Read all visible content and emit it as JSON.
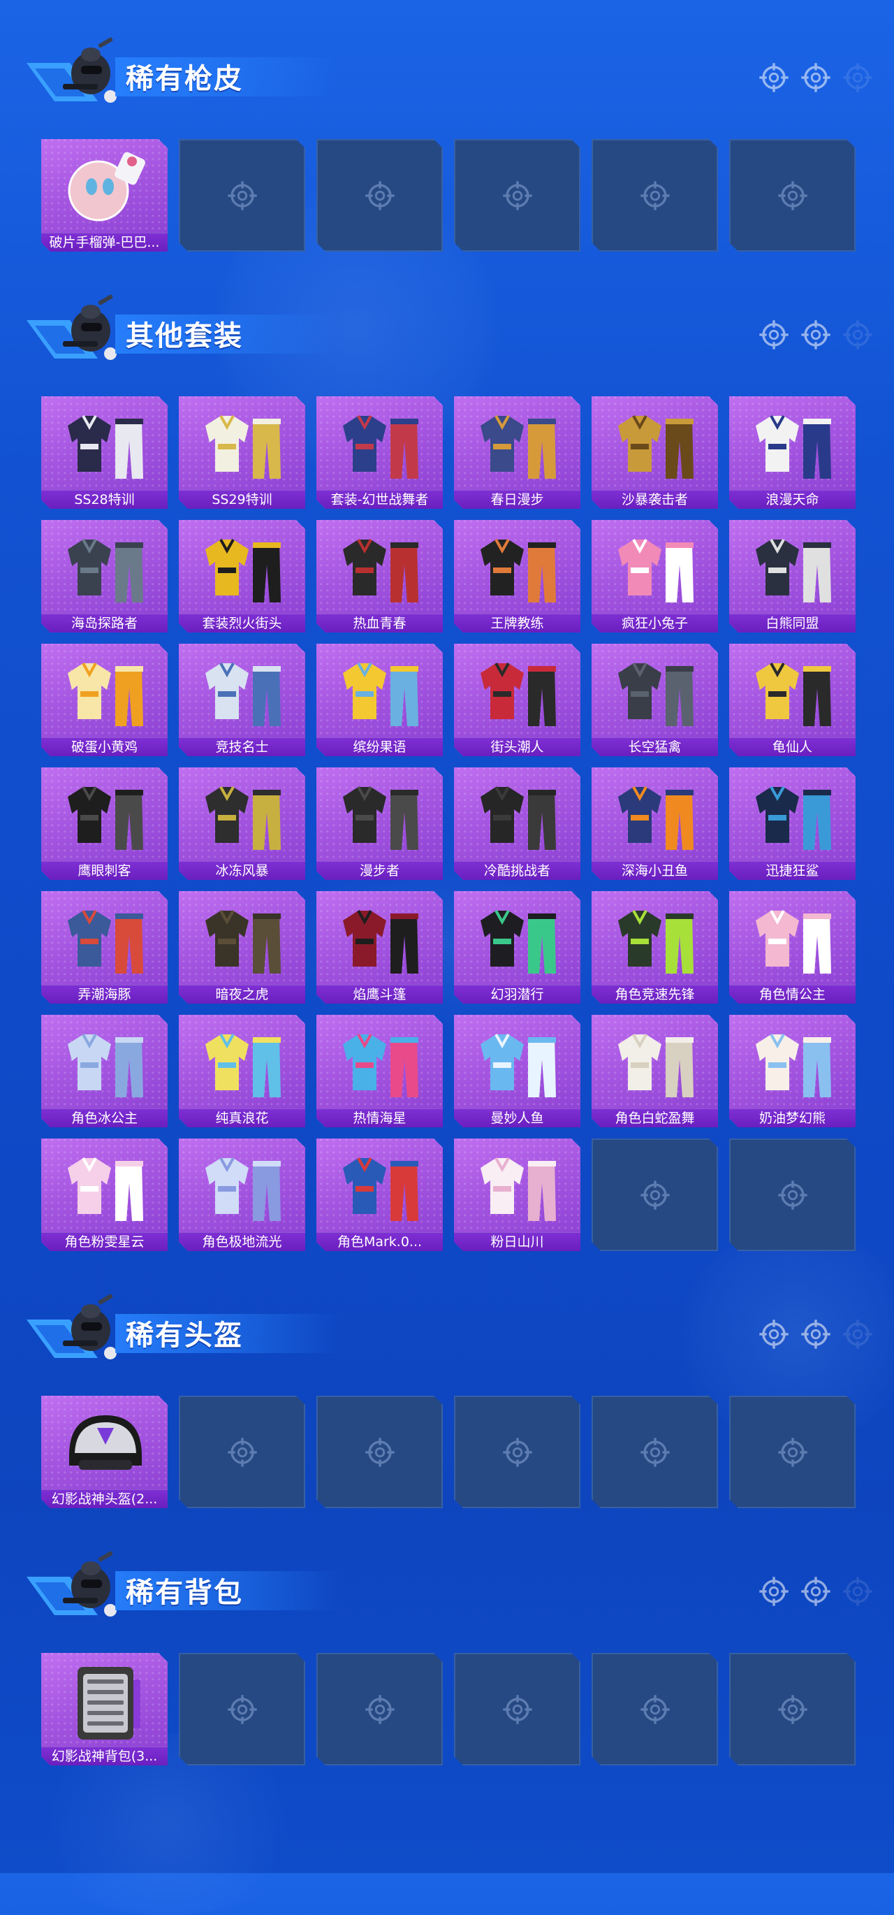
{
  "sections": [
    {
      "title": "稀有枪皮",
      "items": [
        {
          "label": "破片手榴弹-巴巴...",
          "icon": "grenade-skin-icon",
          "color": "#f1c6cf",
          "accent": "#5fb3e0"
        }
      ],
      "empty_slots": 5
    },
    {
      "title": "其他套装",
      "items": [
        {
          "label": "SS28特训",
          "icon": "outfit-icon",
          "color": "#2a2a4a",
          "accent": "#e8e8f0"
        },
        {
          "label": "SS29特训",
          "icon": "outfit-icon",
          "color": "#f2f0e0",
          "accent": "#d8b84a"
        },
        {
          "label": "套装-幻世战舞者",
          "icon": "outfit-icon",
          "color": "#2c3f8a",
          "accent": "#c23a4a"
        },
        {
          "label": "春日漫步",
          "icon": "outfit-icon",
          "color": "#3a4a8a",
          "accent": "#d69a3a"
        },
        {
          "label": "沙暴袭击者",
          "icon": "outfit-icon",
          "color": "#c99a3a",
          "accent": "#6a4a1a"
        },
        {
          "label": "浪漫天命",
          "icon": "outfit-icon",
          "color": "#f2f2f2",
          "accent": "#2a3a8a"
        },
        {
          "label": "海岛探路者",
          "icon": "outfit-icon",
          "color": "#3a4250",
          "accent": "#6a7a8a"
        },
        {
          "label": "套装烈火街头",
          "icon": "outfit-icon",
          "color": "#e8b820",
          "accent": "#1e1e1e"
        },
        {
          "label": "热血青春",
          "icon": "outfit-icon",
          "color": "#2a2a2a",
          "accent": "#b83030"
        },
        {
          "label": "王牌教练",
          "icon": "outfit-icon",
          "color": "#222222",
          "accent": "#e07a3a"
        },
        {
          "label": "疯狂小兔子",
          "icon": "outfit-icon",
          "color": "#f28ab8",
          "accent": "#ffffff"
        },
        {
          "label": "白熊同盟",
          "icon": "outfit-icon",
          "color": "#2a3040",
          "accent": "#e0e0e0"
        },
        {
          "label": "破蛋小黄鸡",
          "icon": "outfit-icon",
          "color": "#f8e6a8",
          "accent": "#f0a020"
        },
        {
          "label": "竞技名士",
          "icon": "outfit-icon",
          "color": "#d8e2f0",
          "accent": "#4a70b8"
        },
        {
          "label": "缤纷果语",
          "icon": "outfit-icon",
          "color": "#f4c830",
          "accent": "#6ab0e0"
        },
        {
          "label": "街头潮人",
          "icon": "outfit-icon",
          "color": "#c82a3a",
          "accent": "#2a2a2a"
        },
        {
          "label": "长空猛禽",
          "icon": "outfit-icon",
          "color": "#3a3e48",
          "accent": "#5a6270"
        },
        {
          "label": "龟仙人",
          "icon": "outfit-icon",
          "color": "#f0c840",
          "accent": "#2a2a2a"
        },
        {
          "label": "鹰眼刺客",
          "icon": "outfit-icon",
          "color": "#1e1e1e",
          "accent": "#4a4a4a"
        },
        {
          "label": "冰冻风暴",
          "icon": "outfit-icon",
          "color": "#2e2e2e",
          "accent": "#c8b040"
        },
        {
          "label": "漫步者",
          "icon": "outfit-icon",
          "color": "#2a2a2a",
          "accent": "#4a4a4a"
        },
        {
          "label": "冷酷挑战者",
          "icon": "outfit-icon",
          "color": "#262626",
          "accent": "#3a3a3a"
        },
        {
          "label": "深海小丑鱼",
          "icon": "outfit-icon",
          "color": "#2a3a7a",
          "accent": "#f08a20"
        },
        {
          "label": "迅捷狂鲨",
          "icon": "outfit-icon",
          "color": "#1a2a4a",
          "accent": "#3a9ad8"
        },
        {
          "label": "弄潮海豚",
          "icon": "outfit-icon",
          "color": "#3a5a9a",
          "accent": "#d84a3a"
        },
        {
          "label": "暗夜之虎",
          "icon": "outfit-icon",
          "color": "#3a3428",
          "accent": "#5a4e38"
        },
        {
          "label": "焰鹰斗篷",
          "icon": "outfit-icon",
          "color": "#8a1a2a",
          "accent": "#1e1e1e"
        },
        {
          "label": "幻羽潜行",
          "icon": "outfit-icon",
          "color": "#1e1e22",
          "accent": "#3ac88a"
        },
        {
          "label": "角色竞速先锋",
          "icon": "outfit-icon",
          "color": "#2a3a2a",
          "accent": "#a8e03a"
        },
        {
          "label": "角色情公主",
          "icon": "outfit-icon",
          "color": "#f4b8d0",
          "accent": "#ffffff"
        },
        {
          "label": "角色冰公主",
          "icon": "outfit-icon",
          "color": "#c8d8f4",
          "accent": "#8aa8e0"
        },
        {
          "label": "纯真浪花",
          "icon": "outfit-icon",
          "color": "#f0e060",
          "accent": "#60c0e8"
        },
        {
          "label": "热情海星",
          "icon": "outfit-icon",
          "color": "#4ab0e8",
          "accent": "#e84a8a"
        },
        {
          "label": "曼妙人鱼",
          "icon": "outfit-icon",
          "color": "#6ab8f0",
          "accent": "#e8f4ff"
        },
        {
          "label": "角色白蛇盈舞",
          "icon": "outfit-icon",
          "color": "#f2eee8",
          "accent": "#d8d0c0"
        },
        {
          "label": "奶油梦幻熊",
          "icon": "outfit-icon",
          "color": "#f8f0e8",
          "accent": "#8ac0f0"
        },
        {
          "label": "角色粉雯星云",
          "icon": "outfit-icon",
          "color": "#f6d0e8",
          "accent": "#ffffff"
        },
        {
          "label": "角色极地流光",
          "icon": "outfit-icon",
          "color": "#d0dcf8",
          "accent": "#8a9ae0"
        },
        {
          "label": "角色Mark.0...",
          "icon": "outfit-icon",
          "color": "#2a5ab8",
          "accent": "#d83a3a"
        },
        {
          "label": "粉日山川",
          "icon": "outfit-icon",
          "color": "#f8eef4",
          "accent": "#e8b0d0"
        }
      ],
      "empty_slots": 2
    },
    {
      "title": "稀有头盔",
      "items": [
        {
          "label": "幻影战神头盔(2...",
          "icon": "helmet-icon",
          "color": "#d8d8e0",
          "accent": "#1a1a1a"
        }
      ],
      "empty_slots": 5
    },
    {
      "title": "稀有背包",
      "items": [
        {
          "label": "幻影战神背包(3...",
          "icon": "backpack-icon",
          "color": "#c8c8d0",
          "accent": "#3a3a3a"
        }
      ],
      "empty_slots": 5
    }
  ],
  "colors": {
    "card_purple": "#a455e0",
    "label_bar": "#7e2fd4",
    "empty_slot": "#264983",
    "background": "#1252d2",
    "title_text": "#ffffff"
  }
}
